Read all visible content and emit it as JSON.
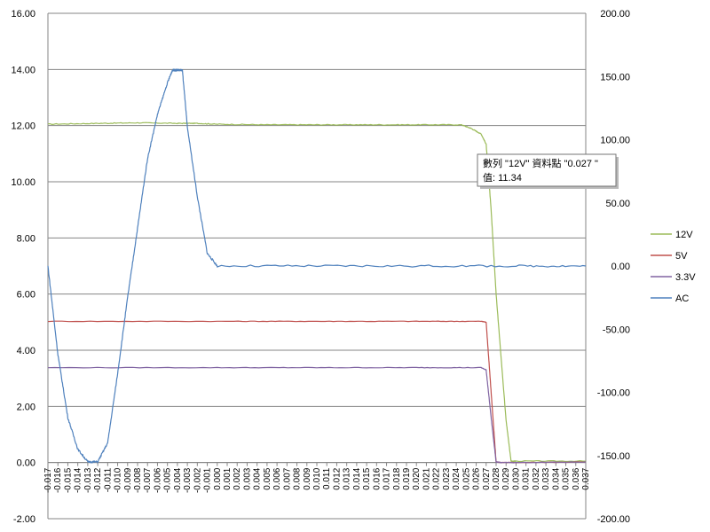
{
  "chart_data": {
    "type": "line",
    "title": "",
    "xlabel": "",
    "ylabel": "",
    "grid": true,
    "legend_position": "right",
    "y_left": {
      "min": -2,
      "max": 16,
      "step": 2,
      "tick_labels": [
        "-2.00",
        "0.00",
        "2.00",
        "4.00",
        "6.00",
        "8.00",
        "10.00",
        "12.00",
        "14.00",
        "16.00"
      ]
    },
    "y_right": {
      "min": -200,
      "max": 200,
      "step": 50,
      "tick_labels": [
        "-200.00",
        "-150.00",
        "-100.00",
        "-50.00",
        "0.00",
        "50.00",
        "100.00",
        "150.00",
        "200.00"
      ]
    },
    "x_axis": {
      "crosses_left_y_at": 0,
      "tick_labels": [
        "-0.017",
        "-0.016",
        "-0.015",
        "-0.014",
        "-0.013",
        "-0.012",
        "-0.011",
        "-0.010",
        "-0.009",
        "-0.008",
        "-0.007",
        "-0.006",
        "-0.005",
        "-0.004",
        "-0.003",
        "-0.002",
        "-0.001",
        "0.000",
        "0.001",
        "0.002",
        "0.003",
        "0.004",
        "0.005",
        "0.006",
        "0.007",
        "0.008",
        "0.009",
        "0.010",
        "0.011",
        "0.012",
        "0.013",
        "0.014",
        "0.015",
        "0.016",
        "0.017",
        "0.018",
        "0.019",
        "0.020",
        "0.021",
        "0.022",
        "0.023",
        "0.024",
        "0.025",
        "0.026",
        "0.027",
        "0.028",
        "0.029",
        "0.030",
        "0.031",
        "0.032",
        "0.033",
        "0.034",
        "0.035",
        "0.036",
        "0.037"
      ]
    },
    "series": [
      {
        "name": "12V",
        "axis": "left",
        "color": "#9bbb59",
        "x": [
          -0.017,
          -0.012,
          -0.008,
          -0.004,
          -0.002,
          0.0,
          0.005,
          0.01,
          0.015,
          0.02,
          0.0245,
          0.0255,
          0.0265,
          0.027,
          0.0275,
          0.028,
          0.029,
          0.0295,
          0.03,
          0.037
        ],
        "y": [
          12.05,
          12.08,
          12.1,
          12.08,
          12.08,
          12.05,
          12.03,
          12.03,
          12.03,
          12.03,
          12.03,
          11.9,
          11.7,
          11.34,
          9.0,
          6.0,
          1.5,
          0.05,
          0.05,
          0.05
        ]
      },
      {
        "name": "5V",
        "axis": "left",
        "color": "#c0504d",
        "x": [
          -0.017,
          0.0,
          0.01,
          0.02,
          0.0265,
          0.027,
          0.0275,
          0.028,
          0.0285,
          0.03,
          0.037
        ],
        "y": [
          5.03,
          5.03,
          5.03,
          5.03,
          5.03,
          5.0,
          2.5,
          0.02,
          0.0,
          0.0,
          0.02
        ]
      },
      {
        "name": "3.3V",
        "axis": "left",
        "color": "#8064a2",
        "x": [
          -0.017,
          0.0,
          0.01,
          0.02,
          0.0265,
          0.027,
          0.0275,
          0.028,
          0.0285,
          0.03,
          0.037
        ],
        "y": [
          3.38,
          3.38,
          3.38,
          3.38,
          3.38,
          3.3,
          1.6,
          0.02,
          0.0,
          0.0,
          0.02
        ]
      },
      {
        "name": "AC",
        "axis": "right",
        "color": "#4f81bd",
        "x": [
          -0.017,
          -0.016,
          -0.015,
          -0.014,
          -0.013,
          -0.012,
          -0.011,
          -0.01,
          -0.009,
          -0.008,
          -0.007,
          -0.006,
          -0.005,
          -0.0045,
          -0.004,
          -0.0035,
          -0.003,
          -0.002,
          -0.001,
          0.0,
          0.01,
          0.02,
          0.03,
          0.037
        ],
        "y": [
          0,
          -70,
          -120,
          -145,
          -155,
          -155,
          -140,
          -85,
          -25,
          30,
          85,
          120,
          145,
          155,
          155,
          155,
          110,
          55,
          10,
          0,
          0,
          0,
          0,
          0
        ]
      }
    ],
    "tooltip": {
      "line1": "數列 \"12V\" 資料點 \"0.027 \"",
      "line2": "值: 11.34",
      "series": "12V",
      "x": 0.027,
      "y": 11.34
    }
  }
}
